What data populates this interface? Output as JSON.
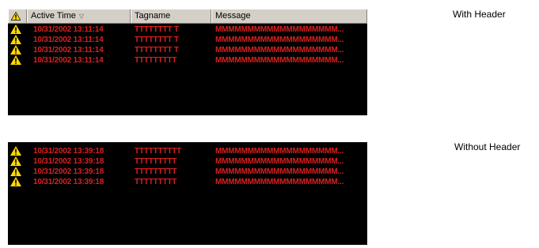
{
  "header": {
    "columns": [
      {
        "label": "",
        "icon": "warning-icon"
      },
      {
        "label": "Active Time",
        "sort_indicator": "▽"
      },
      {
        "label": "Tagname"
      },
      {
        "label": "Message"
      },
      {
        "label": ""
      }
    ]
  },
  "with_header": {
    "label": "With Header",
    "rows": [
      {
        "icon": "warning-icon",
        "time": "10/31/2002 13:11:14",
        "tag": "TTTTTTTT T",
        "message": "MMMMMMMMMMMMMMMMMMM..."
      },
      {
        "icon": "warning-icon",
        "time": "10/31/2002 13:11:14",
        "tag": "TTTTTTTT T",
        "message": "MMMMMMMMMMMMMMMMMMM..."
      },
      {
        "icon": "warning-icon",
        "time": "10/31/2002 13:11:14",
        "tag": "TTTTTTTT T",
        "message": "MMMMMMMMMMMMMMMMMMM..."
      },
      {
        "icon": "warning-icon",
        "time": "10/31/2002 13:11:14",
        "tag": "TTTTTTTTT",
        "message": "MMMMMMMMMMMMMMMMMMM..."
      }
    ]
  },
  "without_header": {
    "label": "Without Header",
    "rows": [
      {
        "icon": "warning-icon",
        "time": "10/31/2002 13:39:18",
        "tag": "TTTTTTTTTT",
        "message": "MMMMMMMMMMMMMMMMMMM..."
      },
      {
        "icon": "warning-icon",
        "time": "10/31/2002 13:39:18",
        "tag": "TTTTTTTTT",
        "message": "MMMMMMMMMMMMMMMMMMM..."
      },
      {
        "icon": "warning-icon",
        "time": "10/31/2002 13:39:18",
        "tag": "TTTTTTTTT",
        "message": "MMMMMMMMMMMMMMMMMMM..."
      },
      {
        "icon": "warning-icon",
        "time": "10/31/2002 13:39:18",
        "tag": "TTTTTTTTT",
        "message": "MMMMMMMMMMMMMMMMMMM..."
      }
    ]
  },
  "colors": {
    "grid_background": "#000000",
    "alarm_text": "#d92020",
    "header_background": "#d4d0c8",
    "warning_yellow": "#ffd800"
  }
}
